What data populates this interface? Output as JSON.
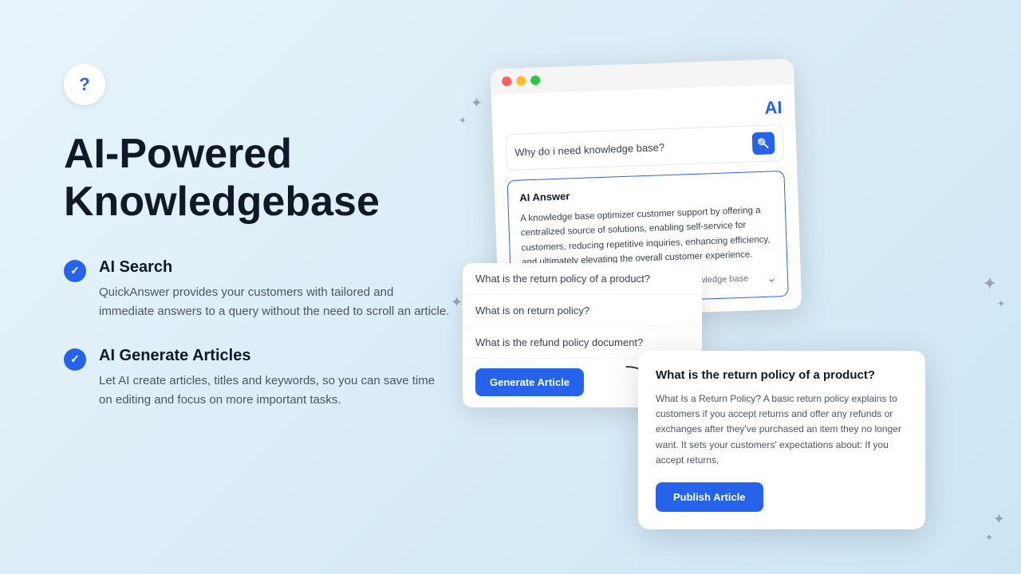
{
  "hero": {
    "icon_label": "?",
    "title_line1": "AI-Powered",
    "title_line2": "Knowledgebase"
  },
  "features": [
    {
      "id": "ai-search",
      "title": "AI Search",
      "description": "QuickAnswer provides your customers with tailored and immediate answers to a query without the need to scroll an article."
    },
    {
      "id": "ai-generate",
      "title": "AI Generate Articles",
      "description": "Let AI create articles, titles and keywords, so you can save time on editing and focus on more important tasks."
    }
  ],
  "ai_window": {
    "logo": "AI",
    "search_query": "Why do i need knowledge base?",
    "search_btn_label": "search",
    "answer_section_title": "AI Answer",
    "answer_text": "A knowledge base optimizer customer support by offering a centralized source of solutions, enabling self-service for customers, reducing repetitive inquiries, enhancing efficiency, and ultimately elevating the overall customer experience.",
    "answer_footer": "This answer is based on articles from our knowledge base"
  },
  "suggestions": {
    "items": [
      "What is the return policy of a product?",
      "What is on return policy?",
      "What is the refund policy document?"
    ],
    "generate_btn": "Generate Article"
  },
  "article_preview": {
    "title": "What is the return policy of a product?",
    "body": "What Is a Return Policy? A basic return policy explains to customers if you accept returns and offer any refunds or exchanges after they've purchased an item they no longer want. It sets your customers' expectations about: If you accept returns,",
    "publish_btn": "Publish Article"
  }
}
